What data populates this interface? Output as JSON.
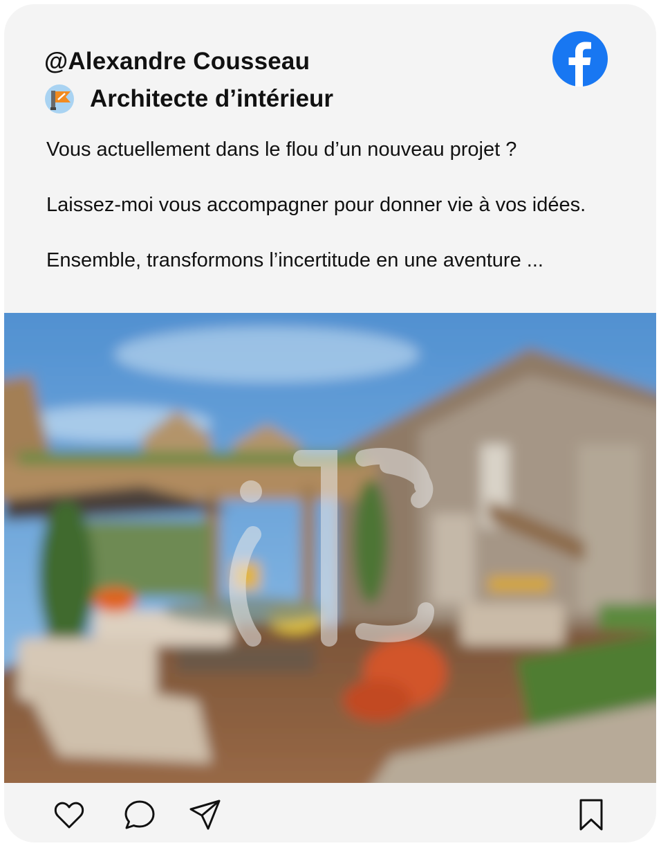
{
  "post": {
    "handle": "@Alexandre Cousseau",
    "role": "Architecte d’intérieur",
    "role_icon": "designer-badge-icon",
    "platform_icon": "facebook-icon",
    "caption": {
      "line1": "Vous actuellement dans le flou d’un nouveau projet ?",
      "line2": "Laissez-moi vous accompagner pour donner vie à vos idées.",
      "line3": "Ensemble, transformons l’incertitude en une aventure ..."
    },
    "image": {
      "description_icon": "blurred-terrace-photo",
      "watermark_icon": "ic-logo-watermark"
    },
    "actions": {
      "like_icon": "heart-icon",
      "comment_icon": "comment-icon",
      "share_icon": "send-icon",
      "save_icon": "bookmark-icon"
    }
  },
  "colors": {
    "card_bg": "#f4f4f4",
    "facebook_blue": "#1877f2",
    "text": "#111111"
  }
}
